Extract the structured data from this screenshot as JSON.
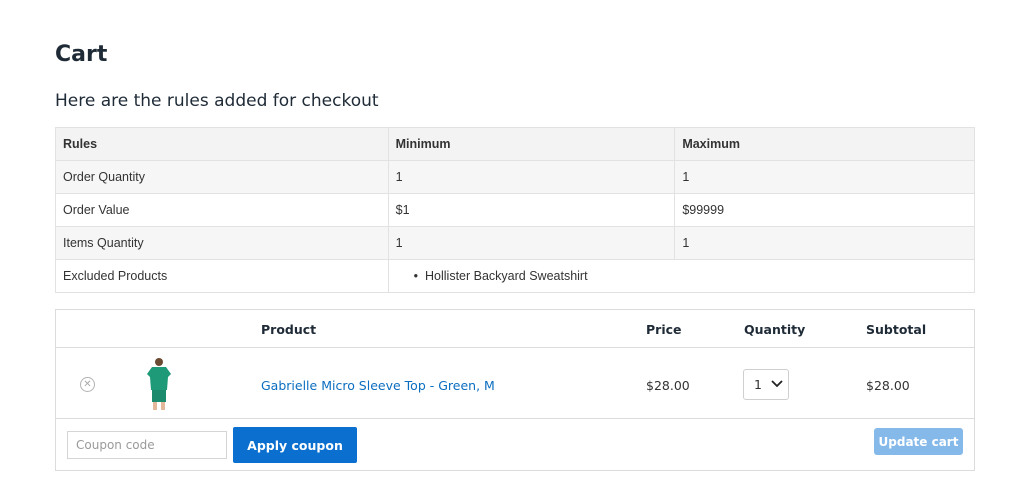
{
  "page": {
    "title": "Cart",
    "rules_heading": "Here are the rules added for checkout"
  },
  "rules_table": {
    "headers": [
      "Rules",
      "Minimum",
      "Maximum"
    ],
    "rows": [
      {
        "rule": "Order Quantity",
        "min": "1",
        "max": "1"
      },
      {
        "rule": "Order Value",
        "min": "$1",
        "max": "$99999"
      },
      {
        "rule": "Items Quantity",
        "min": "1",
        "max": "1"
      }
    ],
    "excluded": {
      "label": "Excluded Products",
      "items": [
        "Hollister Backyard Sweatshirt"
      ]
    }
  },
  "cart": {
    "headers": {
      "product": "Product",
      "price": "Price",
      "quantity": "Quantity",
      "subtotal": "Subtotal"
    },
    "items": [
      {
        "name": "Gabrielle Micro Sleeve Top - Green, M",
        "price": "$28.00",
        "quantity": "1",
        "subtotal": "$28.00",
        "thumbnail_icon": "green-tshirt-image"
      }
    ],
    "coupon_placeholder": "Coupon code",
    "coupon_value": "",
    "apply_label": "Apply coupon",
    "update_label": "Update cart"
  },
  "colors": {
    "link": "#0b6ec0",
    "primary_button": "#0a6fcf",
    "disabled_button": "#85b9ea"
  }
}
